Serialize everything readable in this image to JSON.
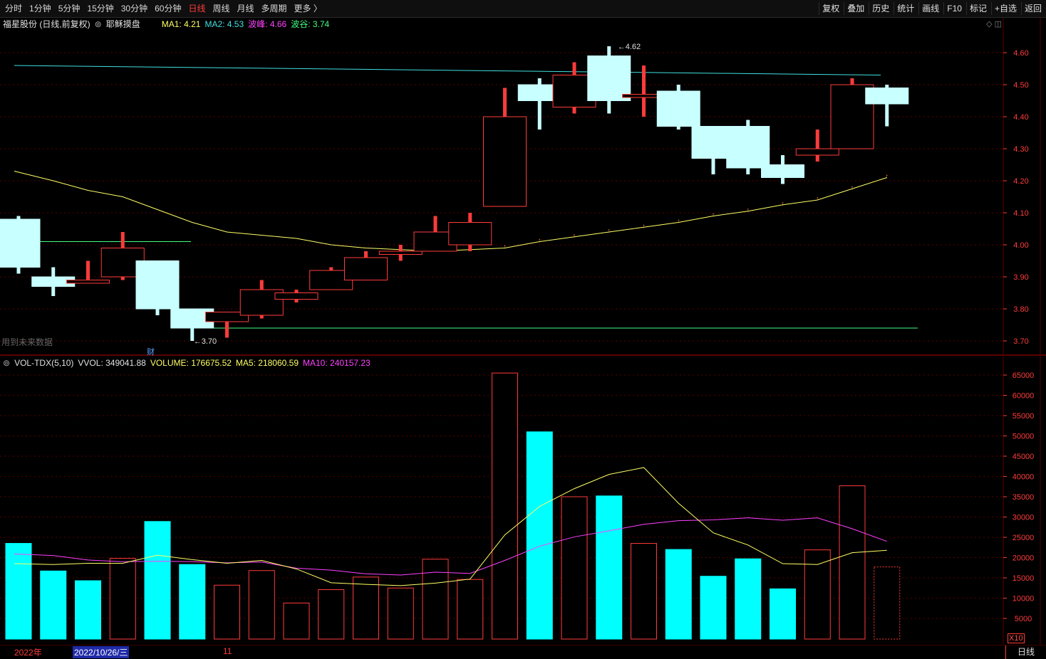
{
  "topbar": {
    "tabs": [
      "分时",
      "1分钟",
      "5分钟",
      "15分钟",
      "30分钟",
      "60分钟",
      "日线",
      "周线",
      "月线",
      "多周期",
      "更多 〉"
    ],
    "active_tab": "日线",
    "tools": [
      "复权",
      "叠加",
      "历史",
      "统计",
      "画线",
      "F10",
      "标记",
      "+自选",
      "返回"
    ]
  },
  "info": {
    "stock": "福星股份 (日线,前复权)",
    "mode_icon": "chevron-circle-icon",
    "mode": "耶稣摸盘",
    "ma1": "MA1: 4.21",
    "ma2": "MA2: 4.53",
    "peak": "波峰: 4.66",
    "valley": "波谷: 3.74",
    "panel_icons": "◇ ◫"
  },
  "vol_info": {
    "name": "VOL-TDX(5,10)",
    "vvol": "VVOL: 349041.88",
    "volume": "VOLUME: 176675.52",
    "ma5": "MA5: 218060.59",
    "ma10": "MA10: 240157.23"
  },
  "notes": {
    "future": "用到未来数据",
    "cai": "财",
    "x10": "X10"
  },
  "bottom": {
    "year": "2022年",
    "cursor_date": "2022/10/26/三",
    "month": "11",
    "period_button": "日线"
  },
  "colors": {
    "up": "#ff3b3b",
    "down": "#c8ffff",
    "vol_down": "#00ffff",
    "ma1": "#ffff66",
    "ma2": "#40e0e0",
    "ma10": "#ff40ff",
    "valley_line": "#40ff80",
    "grid": "#5a0000"
  },
  "chart_data": [
    {
      "type": "candlestick",
      "price_axis": {
        "min": 3.65,
        "max": 4.65,
        "ticks": [
          4.6,
          4.5,
          4.4,
          4.3,
          4.2,
          4.1,
          4.0,
          3.9,
          3.8,
          3.7
        ]
      },
      "candles": [
        {
          "o": 4.08,
          "h": 4.09,
          "l": 3.91,
          "c": 3.93
        },
        {
          "o": 3.9,
          "h": 3.93,
          "l": 3.84,
          "c": 3.87
        },
        {
          "o": 3.88,
          "h": 3.95,
          "l": 3.88,
          "c": 3.89
        },
        {
          "o": 3.9,
          "h": 4.04,
          "l": 3.89,
          "c": 3.99
        },
        {
          "o": 3.95,
          "h": 3.95,
          "l": 3.78,
          "c": 3.8
        },
        {
          "o": 3.8,
          "h": 3.8,
          "l": 3.7,
          "c": 3.74
        },
        {
          "o": 3.76,
          "h": 3.79,
          "l": 3.71,
          "c": 3.79
        },
        {
          "o": 3.78,
          "h": 3.89,
          "l": 3.77,
          "c": 3.86
        },
        {
          "o": 3.83,
          "h": 3.86,
          "l": 3.82,
          "c": 3.85
        },
        {
          "o": 3.86,
          "h": 3.93,
          "l": 3.86,
          "c": 3.92
        },
        {
          "o": 3.89,
          "h": 3.98,
          "l": 3.89,
          "c": 3.96
        },
        {
          "o": 3.97,
          "h": 4.0,
          "l": 3.95,
          "c": 3.98
        },
        {
          "o": 3.98,
          "h": 4.09,
          "l": 3.98,
          "c": 4.04
        },
        {
          "o": 4.0,
          "h": 4.1,
          "l": 3.98,
          "c": 4.07
        },
        {
          "o": 4.12,
          "h": 4.49,
          "l": 4.12,
          "c": 4.4
        },
        {
          "o": 4.5,
          "h": 4.52,
          "l": 4.36,
          "c": 4.45
        },
        {
          "o": 4.43,
          "h": 4.57,
          "l": 4.41,
          "c": 4.53
        },
        {
          "o": 4.59,
          "h": 4.62,
          "l": 4.41,
          "c": 4.45
        },
        {
          "o": 4.46,
          "h": 4.56,
          "l": 4.4,
          "c": 4.47
        },
        {
          "o": 4.48,
          "h": 4.5,
          "l": 4.36,
          "c": 4.37
        },
        {
          "o": 4.37,
          "h": 4.37,
          "l": 4.22,
          "c": 4.27
        },
        {
          "o": 4.37,
          "h": 4.39,
          "l": 4.22,
          "c": 4.24
        },
        {
          "o": 4.25,
          "h": 4.28,
          "l": 4.19,
          "c": 4.21
        },
        {
          "o": 4.28,
          "h": 4.36,
          "l": 4.26,
          "c": 4.3
        },
        {
          "o": 4.3,
          "h": 4.52,
          "l": 4.3,
          "c": 4.5
        },
        {
          "o": 4.49,
          "h": 4.5,
          "l": 4.37,
          "c": 4.44
        }
      ],
      "ma1_points": [
        4.23,
        4.2,
        4.17,
        4.15,
        4.11,
        4.07,
        4.04,
        4.03,
        4.02,
        4.0,
        3.99,
        3.985,
        3.98,
        3.985,
        3.99,
        4.01,
        4.025,
        4.04,
        4.055,
        4.07,
        4.09,
        4.105,
        4.125,
        4.14,
        4.175,
        4.21
      ],
      "ma2_line": [
        4.56,
        4.53
      ],
      "valley": 3.74,
      "peak_label": "4.62",
      "low_label": "3.70",
      "ref_line": 4.01
    },
    {
      "type": "volume",
      "axis": {
        "min": 0,
        "max": 68000,
        "ticks": [
          65000,
          60000,
          55000,
          50000,
          45000,
          40000,
          35000,
          30000,
          25000,
          20000,
          15000,
          10000,
          5000
        ]
      },
      "volumes": [
        23500,
        16700,
        14300,
        19800,
        28900,
        18300,
        13200,
        16800,
        8800,
        12100,
        15200,
        12500,
        19600,
        14600,
        65500,
        51000,
        35000,
        35200,
        23500,
        22000,
        15400,
        19700,
        12300,
        21900,
        37700,
        17700
      ],
      "up": [
        false,
        false,
        false,
        true,
        false,
        false,
        true,
        true,
        true,
        true,
        true,
        true,
        true,
        true,
        true,
        false,
        true,
        false,
        true,
        false,
        false,
        false,
        false,
        true,
        true,
        true
      ],
      "ma5": [
        18500,
        18300,
        18600,
        18600,
        20600,
        19500,
        18600,
        19300,
        17200,
        13800,
        13400,
        13100,
        13700,
        14700,
        25600,
        32600,
        37000,
        40500,
        42200,
        33400,
        26100,
        23100,
        18500,
        18300,
        21200,
        21800
      ],
      "ma10": [
        20900,
        20500,
        19400,
        19000,
        19100,
        19000,
        18700,
        18900,
        17400,
        16900,
        16000,
        15700,
        16400,
        16100,
        19300,
        22800,
        25100,
        26600,
        28200,
        29100,
        29300,
        29800,
        29200,
        29800,
        27100,
        24000
      ]
    }
  ]
}
